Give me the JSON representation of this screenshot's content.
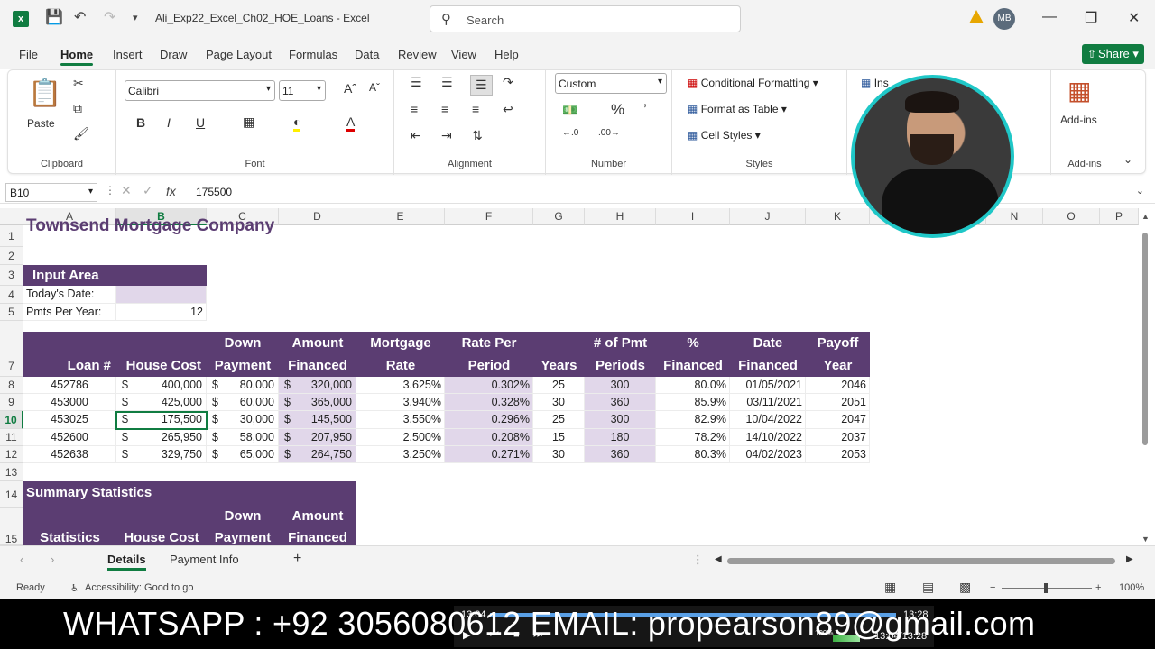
{
  "titlebar": {
    "filename": "Ali_Exp22_Excel_Ch02_HOE_Loans",
    "app": "Excel",
    "search_placeholder": "Search",
    "user_initials": "MB"
  },
  "menu": [
    "File",
    "Home",
    "Insert",
    "Draw",
    "Page Layout",
    "Formulas",
    "Data",
    "Review",
    "View",
    "Help"
  ],
  "share_label": "Share",
  "ribbon": {
    "paste": "Paste",
    "font_name": "Calibri",
    "font_size": "11",
    "number_format": "Custom",
    "conditional_formatting": "Conditional Formatting",
    "format_as_table": "Format as Table",
    "cell_styles": "Cell Styles",
    "insert": "Ins",
    "addins": "Add-ins",
    "groups": {
      "clipboard": "Clipboard",
      "font": "Font",
      "alignment": "Alignment",
      "number": "Number",
      "styles": "Styles",
      "addins": "Add-ins"
    }
  },
  "formula_bar": {
    "name_box": "B10",
    "fx": "fx",
    "value": "175500"
  },
  "columns": [
    "A",
    "B",
    "C",
    "D",
    "E",
    "F",
    "G",
    "H",
    "I",
    "J",
    "K",
    "N",
    "O",
    "P"
  ],
  "rows": [
    "1",
    "2",
    "3",
    "4",
    "5",
    "7",
    "8",
    "9",
    "10",
    "11",
    "12",
    "13",
    "14",
    "15"
  ],
  "sheet": {
    "title": "Townsend Mortgage Company",
    "input_area": "Input Area",
    "todays_date_label": "Today's Date:",
    "pmts_label": "Pmts Per Year:",
    "pmts_value": "12",
    "headers": {
      "top": [
        "",
        "",
        "Down",
        "Amount",
        "Mortgage",
        "Rate Per",
        "",
        "# of Pmt",
        "%",
        "Date",
        "Payoff"
      ],
      "bottom": [
        "Loan #",
        "House Cost",
        "Payment",
        "Financed",
        "Rate",
        "Period",
        "Years",
        "Periods",
        "Financed",
        "Financed",
        "Year"
      ]
    },
    "loans": [
      [
        "452786",
        "$",
        "400,000",
        "$",
        "80,000",
        "$",
        "320,000",
        "3.625%",
        "0.302%",
        "25",
        "300",
        "80.0%",
        "01/05/2021",
        "2046"
      ],
      [
        "453000",
        "$",
        "425,000",
        "$",
        "60,000",
        "$",
        "365,000",
        "3.940%",
        "0.328%",
        "30",
        "360",
        "85.9%",
        "03/11/2021",
        "2051"
      ],
      [
        "453025",
        "$",
        "175,500",
        "$",
        "30,000",
        "$",
        "145,500",
        "3.550%",
        "0.296%",
        "25",
        "300",
        "82.9%",
        "10/04/2022",
        "2047"
      ],
      [
        "452600",
        "$",
        "265,950",
        "$",
        "58,000",
        "$",
        "207,950",
        "2.500%",
        "0.208%",
        "15",
        "180",
        "78.2%",
        "14/10/2022",
        "2037"
      ],
      [
        "452638",
        "$",
        "329,750",
        "$",
        "65,000",
        "$",
        "264,750",
        "3.250%",
        "0.271%",
        "30",
        "360",
        "80.3%",
        "04/02/2023",
        "2053"
      ]
    ],
    "summary_title": "Summary Statistics",
    "summary_headers": {
      "top": [
        "",
        "",
        "Down",
        "Amount"
      ],
      "bottom": [
        "Statistics",
        "House Cost",
        "Payment",
        "Financed"
      ]
    }
  },
  "tabs": [
    "Details",
    "Payment Info"
  ],
  "status": {
    "ready": "Ready",
    "accessibility": "Accessibility: Good to go",
    "zoom": "100%"
  },
  "banner": "WHATSAPP : +92 3056080612  EMAIL: propearson89@gmail.com",
  "player": {
    "time_start": "13:04",
    "time_end": "13:28",
    "volume": "100%",
    "time_display": "13:04/13:28"
  }
}
